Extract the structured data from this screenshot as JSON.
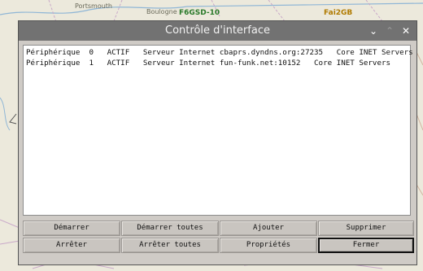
{
  "background_map": {
    "labels": [
      "Portsmouth",
      "Boulogne",
      "F6GSD-10",
      "Fai2GB"
    ]
  },
  "window": {
    "title": "Contrôle d'interface",
    "controls": {
      "minimize": "⌄",
      "maximize": "⌃",
      "close": "✕"
    }
  },
  "interfaces": [
    "Périphérique  0   ACTIF   Serveur Internet cbaprs.dyndns.org:27235   Core INET Servers",
    "Périphérique  1   ACTIF   Serveur Internet fun-funk.net:10152   Core INET Servers"
  ],
  "buttons": {
    "start": "Démarrer",
    "start_all": "Démarrer toutes",
    "add": "Ajouter",
    "delete": "Supprimer",
    "stop": "Arrêter",
    "stop_all": "Arrêter toutes",
    "properties": "Propriétés",
    "close": "Fermer"
  }
}
